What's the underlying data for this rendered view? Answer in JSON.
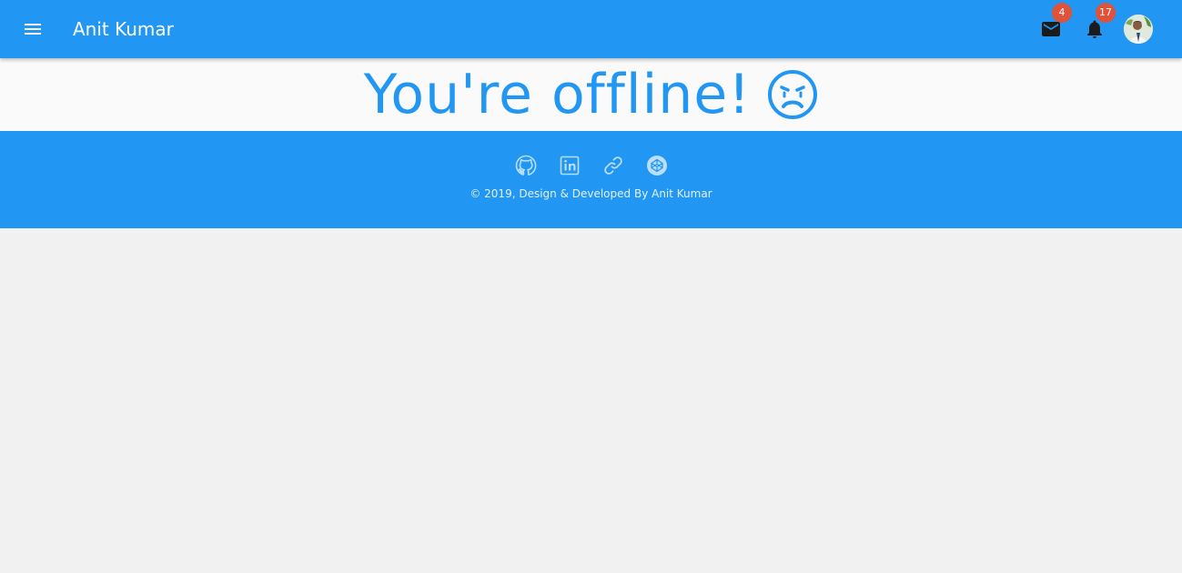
{
  "header": {
    "title": "Anit Kumar",
    "menu_icon": "menu-icon",
    "mail": {
      "icon": "mail-icon",
      "badge": "4"
    },
    "notifications": {
      "icon": "bell-icon",
      "badge": "17"
    },
    "avatar": "profile-avatar"
  },
  "offline": {
    "message": "You're offline!",
    "emoji_icon": "sad-face-icon"
  },
  "footer": {
    "social_links": [
      {
        "icon": "github-icon"
      },
      {
        "icon": "linkedin-icon"
      },
      {
        "icon": "link-icon"
      },
      {
        "icon": "codepen-icon"
      }
    ],
    "copyright": "© 2019, Design & Developed By Anit Kumar"
  },
  "colors": {
    "primary": "#2196f3",
    "badge": "#e0523a",
    "background": "#f1f1f1",
    "banner_background": "#fafafa"
  }
}
